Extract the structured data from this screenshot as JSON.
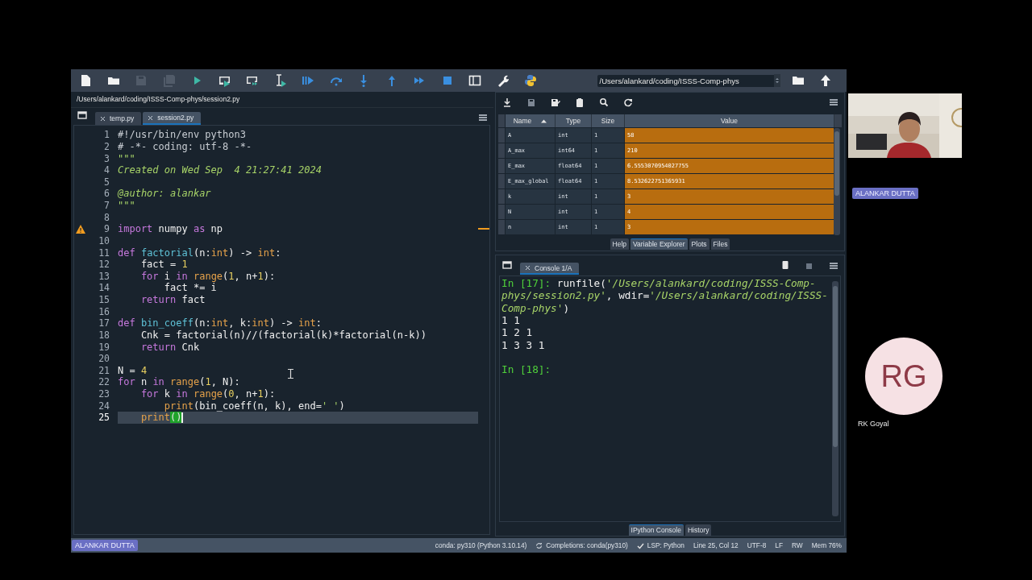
{
  "toolbar": {
    "buttons": [
      {
        "disabled": false
      },
      {
        "disabled": false
      },
      {
        "disabled": true
      },
      {
        "disabled": true
      },
      {
        "disabled": false
      },
      {
        "disabled": false
      },
      {
        "disabled": false
      },
      {
        "disabled": false
      },
      {
        "disabled": false
      },
      {
        "disabled": false
      },
      {
        "disabled": false
      },
      {
        "disabled": false
      },
      {
        "disabled": false
      },
      {
        "disabled": false
      },
      {
        "disabled": false
      },
      {
        "disabled": false
      },
      {
        "disabled": false
      }
    ],
    "path_field": {
      "value": "/Users/alankard/coding/ISSS-Comp-phys"
    }
  },
  "editor": {
    "file_path": "/Users/alankard/coding/ISSS-Comp-phys/session2.py",
    "tabs": [
      {
        "label": "temp.py",
        "selected": false
      },
      {
        "label": "session2.py",
        "selected": true
      }
    ],
    "lines": [
      {
        "number": "1",
        "tokens": [
          {
            "kind": "comment",
            "text": "#!/usr/bin/env python3"
          }
        ]
      },
      {
        "number": "2",
        "tokens": [
          {
            "kind": "comment",
            "text": "# -*- coding: utf-8 -*-"
          }
        ]
      },
      {
        "number": "3",
        "tokens": [
          {
            "kind": "doc",
            "text": "\"\"\""
          }
        ]
      },
      {
        "number": "4",
        "tokens": [
          {
            "kind": "doc",
            "text": "Created on Wed Sep  4 21:27:41 2024"
          }
        ]
      },
      {
        "number": "5"
      },
      {
        "number": "6",
        "tokens": [
          {
            "kind": "doc",
            "text": "@author: alankar"
          }
        ]
      },
      {
        "number": "7",
        "tokens": [
          {
            "kind": "doc",
            "text": "\"\"\""
          }
        ]
      },
      {
        "number": "8"
      },
      {
        "number": "9",
        "warning": true,
        "tokens": [
          {
            "kind": "kw",
            "text": "import"
          },
          {
            "kind": "plain",
            "text": " numpy "
          },
          {
            "kind": "kw",
            "text": "as"
          },
          {
            "kind": "plain",
            "text": " np"
          }
        ]
      },
      {
        "number": "10"
      },
      {
        "number": "11",
        "tokens": [
          {
            "kind": "kw",
            "text": "def "
          },
          {
            "kind": "fn",
            "text": "factorial"
          },
          {
            "kind": "plain",
            "text": "(n:"
          },
          {
            "kind": "builtin",
            "text": "int"
          },
          {
            "kind": "plain",
            "text": ") -> "
          },
          {
            "kind": "builtin",
            "text": "int"
          },
          {
            "kind": "plain",
            "text": ":"
          }
        ]
      },
      {
        "number": "12",
        "tokens": [
          {
            "kind": "plain",
            "text": "    fact = "
          },
          {
            "kind": "num",
            "text": "1"
          }
        ]
      },
      {
        "number": "13",
        "tokens": [
          {
            "kind": "kw",
            "text": "    for"
          },
          {
            "kind": "plain",
            "text": " i "
          },
          {
            "kind": "kw",
            "text": "in "
          },
          {
            "kind": "builtin",
            "text": "range"
          },
          {
            "kind": "plain",
            "text": "("
          },
          {
            "kind": "num",
            "text": "1"
          },
          {
            "kind": "plain",
            "text": ", n+"
          },
          {
            "kind": "num",
            "text": "1"
          },
          {
            "kind": "plain",
            "text": "):"
          }
        ]
      },
      {
        "number": "14",
        "tokens": [
          {
            "kind": "plain",
            "text": "        fact *= i"
          }
        ]
      },
      {
        "number": "15",
        "tokens": [
          {
            "kind": "kw",
            "text": "    return"
          },
          {
            "kind": "plain",
            "text": " fact"
          }
        ]
      },
      {
        "number": "16"
      },
      {
        "number": "17",
        "tokens": [
          {
            "kind": "kw",
            "text": "def "
          },
          {
            "kind": "fn",
            "text": "bin_coeff"
          },
          {
            "kind": "plain",
            "text": "(n:"
          },
          {
            "kind": "builtin",
            "text": "int"
          },
          {
            "kind": "plain",
            "text": ", k:"
          },
          {
            "kind": "builtin",
            "text": "int"
          },
          {
            "kind": "plain",
            "text": ") -> "
          },
          {
            "kind": "builtin",
            "text": "int"
          },
          {
            "kind": "plain",
            "text": ":"
          }
        ]
      },
      {
        "number": "18",
        "tokens": [
          {
            "kind": "plain",
            "text": "    Cnk = factorial(n)//(factorial(k)*factorial(n-k))"
          }
        ]
      },
      {
        "number": "19",
        "tokens": [
          {
            "kind": "kw",
            "text": "    return"
          },
          {
            "kind": "plain",
            "text": " Cnk"
          }
        ]
      },
      {
        "number": "20"
      },
      {
        "number": "21",
        "tokens": [
          {
            "kind": "plain",
            "text": "N = "
          },
          {
            "kind": "num",
            "text": "4"
          }
        ]
      },
      {
        "number": "22",
        "tokens": [
          {
            "kind": "kw",
            "text": "for"
          },
          {
            "kind": "plain",
            "text": " n "
          },
          {
            "kind": "kw",
            "text": "in "
          },
          {
            "kind": "builtin",
            "text": "range"
          },
          {
            "kind": "plain",
            "text": "("
          },
          {
            "kind": "num",
            "text": "1"
          },
          {
            "kind": "plain",
            "text": ", N):"
          }
        ]
      },
      {
        "number": "23",
        "tokens": [
          {
            "kind": "kw",
            "text": "    for"
          },
          {
            "kind": "plain",
            "text": " k "
          },
          {
            "kind": "kw",
            "text": "in "
          },
          {
            "kind": "builtin",
            "text": "range"
          },
          {
            "kind": "plain",
            "text": "("
          },
          {
            "kind": "num",
            "text": "0"
          },
          {
            "kind": "plain",
            "text": ", n+"
          },
          {
            "kind": "num",
            "text": "1"
          },
          {
            "kind": "plain",
            "text": "):"
          }
        ]
      },
      {
        "number": "24",
        "tokens": [
          {
            "kind": "builtin",
            "text": "        print"
          },
          {
            "kind": "plain",
            "text": "(bin_coeff(n, k), end="
          },
          {
            "kind": "str",
            "text": "' '"
          },
          {
            "kind": "plain",
            "text": ")"
          }
        ]
      },
      {
        "number": "25",
        "current": true,
        "tokens": [
          {
            "kind": "builtin",
            "text": "    print"
          },
          {
            "kind": "match",
            "text": "()"
          }
        ]
      }
    ]
  },
  "variable_explorer": {
    "columns": [
      "Name",
      "Type",
      "Size",
      "Value"
    ],
    "rows": [
      {
        "name": "A",
        "type": "int",
        "size": "1",
        "value": "58"
      },
      {
        "name": "A_max",
        "type": "int64",
        "size": "1",
        "value": "210"
      },
      {
        "name": "E_max",
        "type": "float64",
        "size": "1",
        "value": "6.5553070954027755"
      },
      {
        "name": "E_max_global",
        "type": "float64",
        "size": "1",
        "value": "8.532622751365931"
      },
      {
        "name": "k",
        "type": "int",
        "size": "1",
        "value": "3"
      },
      {
        "name": "N",
        "type": "int",
        "size": "1",
        "value": "4"
      },
      {
        "name": "n",
        "type": "int",
        "size": "1",
        "value": "3"
      }
    ],
    "tabs": [
      {
        "label": "Help",
        "selected": false
      },
      {
        "label": "Variable Explorer",
        "selected": true
      },
      {
        "label": "Plots",
        "selected": false
      },
      {
        "label": "Files",
        "selected": false
      }
    ]
  },
  "console": {
    "tab": "Console 1/A",
    "blocks": [
      {
        "lines": [
          {
            "tokens": [
              {
                "kind": "prompt",
                "text": "In [17]: "
              },
              {
                "kind": "plain",
                "text": "runfile("
              },
              {
                "kind": "str",
                "text": "'/Users/alankard/coding/ISSS-Comp-"
              }
            ]
          },
          {
            "tokens": [
              {
                "kind": "str",
                "text": "phys/session2.py'"
              },
              {
                "kind": "plain",
                "text": ", wdir="
              },
              {
                "kind": "str",
                "text": "'/Users/alankard/coding/ISSS-"
              }
            ]
          },
          {
            "tokens": [
              {
                "kind": "str",
                "text": "Comp-phys'"
              },
              {
                "kind": "plain",
                "text": ")"
              }
            ]
          },
          {
            "tokens": [
              {
                "kind": "plain",
                "text": "1 1"
              }
            ]
          },
          {
            "tokens": [
              {
                "kind": "plain",
                "text": "1 2 1"
              }
            ]
          },
          {
            "tokens": [
              {
                "kind": "plain",
                "text": "1 3 3 1"
              }
            ]
          }
        ]
      },
      {
        "lines": [
          {
            "tokens": [
              {
                "kind": "prompt",
                "text": "In [18]:"
              }
            ]
          }
        ]
      }
    ],
    "tabs": [
      {
        "label": "IPython Console",
        "selected": true
      },
      {
        "label": "History",
        "selected": false
      }
    ]
  },
  "status_bar": {
    "name_tag": "ALANKAR DUTTA",
    "items": [
      {
        "text": "conda: py310 (Python 3.10.14)"
      },
      {
        "text": "Completions: conda(py310)"
      },
      {
        "text": "LSP: Python"
      },
      {
        "text": "Line 25, Col 12"
      },
      {
        "text": "UTF-8"
      },
      {
        "text": "LF"
      },
      {
        "text": "RW"
      },
      {
        "text": "Mem 76%"
      }
    ]
  },
  "participants": [
    {
      "kind": "video",
      "name": "ALANKAR DUTTA"
    },
    {
      "kind": "avatar",
      "initials": "RG",
      "name": "RK Goyal"
    }
  ]
}
